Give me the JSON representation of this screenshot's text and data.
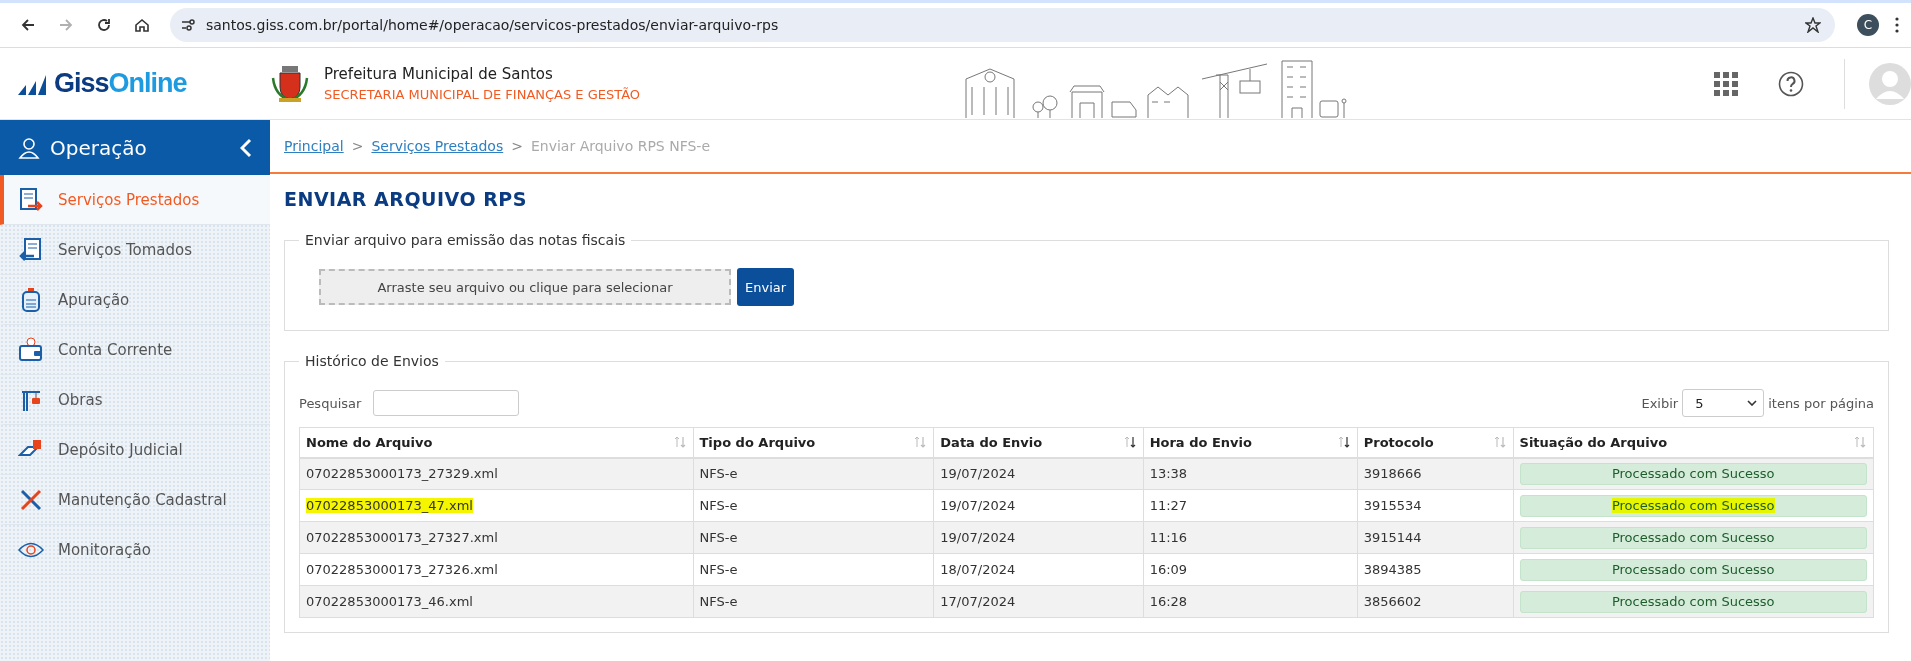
{
  "browser": {
    "url": "santos.giss.com.br/portal/home#/operacao/servicos-prestados/enviar-arquivo-rps",
    "profile_initial": "C",
    "forward_disabled": true
  },
  "header": {
    "logo_parts": [
      "Giss",
      "Online"
    ],
    "org_title": "Prefeitura Municipal de Santos",
    "org_subtitle": "SECRETARIA MUNICIPAL DE FINANÇAS E GESTÃO"
  },
  "sidebar": {
    "title": "Operação",
    "items": [
      {
        "label": "Serviços Prestados",
        "selected": true
      },
      {
        "label": "Serviços Tomados",
        "selected": false
      },
      {
        "label": "Apuração",
        "selected": false
      },
      {
        "label": "Conta Corrente",
        "selected": false
      },
      {
        "label": "Obras",
        "selected": false
      },
      {
        "label": "Depósito Judicial",
        "selected": false
      },
      {
        "label": "Manutenção Cadastral",
        "selected": false
      },
      {
        "label": "Monitoração",
        "selected": false
      }
    ]
  },
  "breadcrumb_separator": ">",
  "breadcrumb": [
    {
      "label": "Principal",
      "kind": "link"
    },
    {
      "label": "Serviços Prestados",
      "kind": "link"
    },
    {
      "label": "Enviar Arquivo RPS NFS-e",
      "kind": "current"
    }
  ],
  "page_title": "ENVIAR ARQUIVO RPS",
  "upload": {
    "legend": "Enviar arquivo para emissão das notas fiscais",
    "dropzone_text": "Arraste seu arquivo ou clique para selecionar",
    "button": "Enviar"
  },
  "history": {
    "legend": "Histórico de Envios",
    "search_label": "Pesquisar",
    "show_label": "Exibir",
    "page_size": "5",
    "per_page_label": "itens por página",
    "columns": [
      {
        "label": "Nome do Arquivo",
        "sorted": false
      },
      {
        "label": "Tipo do Arquivo",
        "sorted": false
      },
      {
        "label": "Data do Envio",
        "sorted": true
      },
      {
        "label": "Hora do Envio",
        "sorted": true
      },
      {
        "label": "Protocolo",
        "sorted": false
      },
      {
        "label": "Situação do Arquivo",
        "sorted": false
      }
    ],
    "rows": [
      {
        "cells": [
          "07022853000173_27329.xml",
          "NFS-e",
          "19/07/2024",
          "13:38",
          "3918666",
          "Processado com Sucesso"
        ],
        "highlighted": false
      },
      {
        "cells": [
          "07022853000173_47.xml",
          "NFS-e",
          "19/07/2024",
          "11:27",
          "3915534",
          "Processado com Sucesso"
        ],
        "highlighted": true
      },
      {
        "cells": [
          "07022853000173_27327.xml",
          "NFS-e",
          "19/07/2024",
          "11:16",
          "3915144",
          "Processado com Sucesso"
        ],
        "highlighted": false
      },
      {
        "cells": [
          "07022853000173_27326.xml",
          "NFS-e",
          "18/07/2024",
          "16:09",
          "3894385",
          "Processado com Sucesso"
        ],
        "highlighted": false
      },
      {
        "cells": [
          "07022853000173_46.xml",
          "NFS-e",
          "17/07/2024",
          "16:28",
          "3856602",
          "Processado com Sucesso"
        ],
        "highlighted": false
      }
    ]
  }
}
